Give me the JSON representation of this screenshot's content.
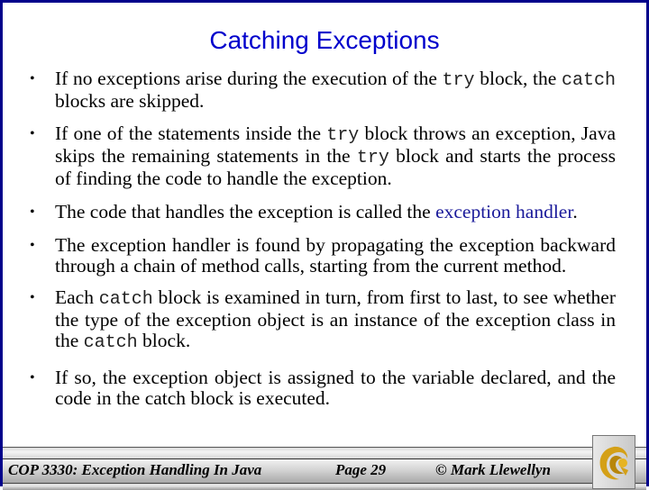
{
  "slide": {
    "title": "Catching Exceptions",
    "bullets": [
      {
        "parts": [
          {
            "t": "If no exceptions arise during the execution of the "
          },
          {
            "t": "try",
            "code": true
          },
          {
            "t": " block, the "
          },
          {
            "t": "catch",
            "code": true
          },
          {
            "t": " blocks are skipped."
          }
        ]
      },
      {
        "parts": [
          {
            "t": "If one of the statements inside the "
          },
          {
            "t": "try",
            "code": true
          },
          {
            "t": " block throws an exception, Java skips the remaining statements in the "
          },
          {
            "t": "try",
            "code": true
          },
          {
            "t": " block and starts the process of finding the code to handle the exception."
          }
        ]
      },
      {
        "parts": [
          {
            "t": "The code that handles the exception is called the "
          },
          {
            "t": "exception handler",
            "highlight": true
          },
          {
            "t": "."
          }
        ]
      },
      {
        "parts": [
          {
            "t": "The exception handler is found by propagating the exception backward through a chain of method calls, starting from the current method."
          }
        ]
      },
      {
        "parts": [
          {
            "t": "Each "
          },
          {
            "t": "catch",
            "code": true
          },
          {
            "t": " block is examined in turn, from first to last, to see whether the type of the exception object is an instance of the exception class in the "
          },
          {
            "t": "catch",
            "code": true
          },
          {
            "t": " block."
          }
        ]
      },
      {
        "parts": [
          {
            "t": "If so, the exception object is assigned to the variable declared, and the code in the catch block is executed."
          }
        ]
      }
    ],
    "bullet_glyph": "•"
  },
  "footer": {
    "course": "COP 3330:  Exception Handling In Java",
    "page": "Page 29",
    "copyright": "© Mark Llewellyn",
    "logo_icon": "pegasus-logo-icon"
  },
  "colors": {
    "border": "#00008b",
    "title": "#0000cc",
    "highlight": "#1a1a9a",
    "logo_gold": "#d4a017"
  }
}
